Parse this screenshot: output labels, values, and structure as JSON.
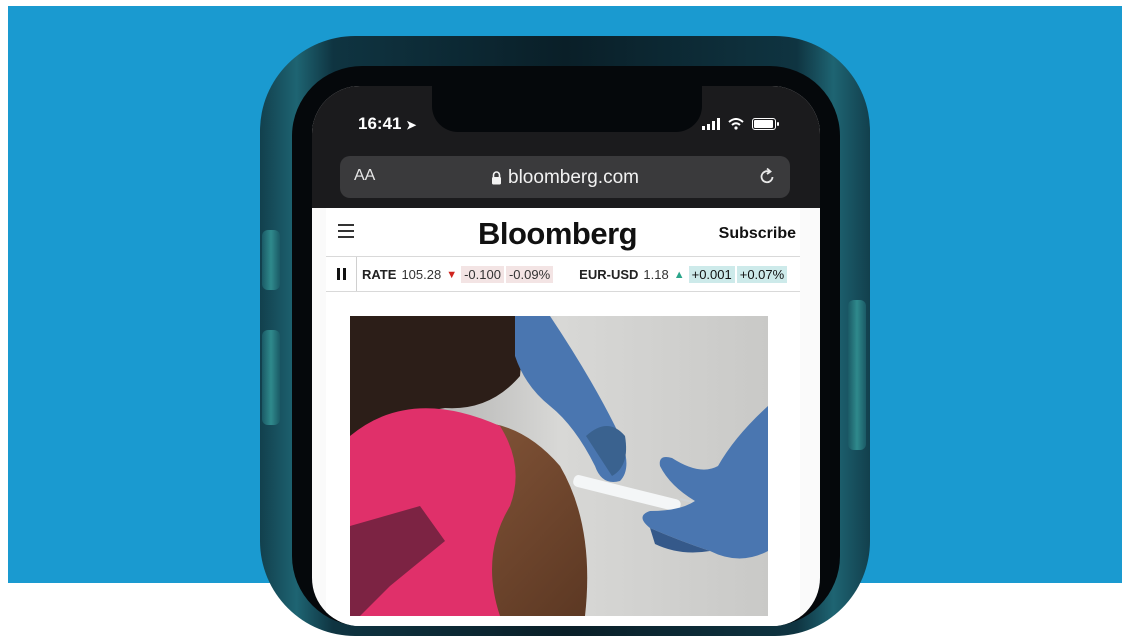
{
  "status_bar": {
    "time": "16:41"
  },
  "browser": {
    "text_size_label": "AA",
    "url": "bloomberg.com"
  },
  "site": {
    "logo": "Bloomberg",
    "subscribe_label": "Subscribe"
  },
  "ticker": {
    "items": [
      {
        "name": "RATE",
        "value": "105.28",
        "direction": "down",
        "change": "-0.100",
        "change_pct": "-0.09%"
      },
      {
        "name": "EUR-USD",
        "value": "1.18",
        "direction": "up",
        "change": "+0.001",
        "change_pct": "+0.07%"
      }
    ]
  },
  "colors": {
    "backdrop": "#1a9ad0",
    "ticker_down": "#d0251f",
    "ticker_up": "#2ba58a",
    "glove": "#4a76b0",
    "shirt": "#e0306a"
  },
  "article": {
    "image_subject": "vaccination-photo"
  }
}
